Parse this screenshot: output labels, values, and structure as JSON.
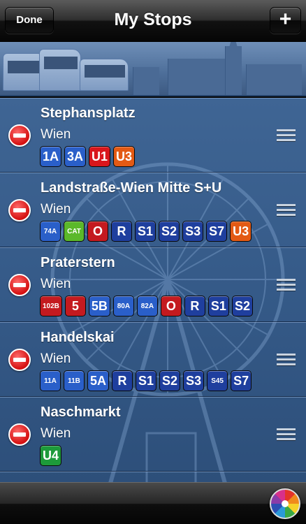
{
  "navbar": {
    "title": "My Stops",
    "done_label": "Done",
    "add_label": "+"
  },
  "stops": [
    {
      "name": "Stephansplatz",
      "city": "Wien",
      "lines": [
        {
          "label": "1A",
          "color": "#2a5fc9",
          "size": "l"
        },
        {
          "label": "3A",
          "color": "#2a5fc9",
          "size": "l"
        },
        {
          "label": "U1",
          "color": "#d9161c",
          "size": "l"
        },
        {
          "label": "U3",
          "color": "#e35a14",
          "size": "l"
        }
      ]
    },
    {
      "name": "Landstraße-Wien Mitte S+U",
      "city": "Wien",
      "lines": [
        {
          "label": "74A",
          "color": "#2a5fc9",
          "size": "s"
        },
        {
          "label": "CAT",
          "color": "#5bb82a",
          "size": "s"
        },
        {
          "label": "O",
          "color": "#c41a1f",
          "size": "l"
        },
        {
          "label": "R",
          "color": "#1f3f9e",
          "size": "l"
        },
        {
          "label": "S1",
          "color": "#1f3f9e",
          "size": "l"
        },
        {
          "label": "S2",
          "color": "#1f3f9e",
          "size": "l"
        },
        {
          "label": "S3",
          "color": "#1f3f9e",
          "size": "l"
        },
        {
          "label": "S7",
          "color": "#1f3f9e",
          "size": "l"
        },
        {
          "label": "U3",
          "color": "#e35a14",
          "size": "l"
        }
      ]
    },
    {
      "name": "Praterstern",
      "city": "Wien",
      "lines": [
        {
          "label": "102B",
          "color": "#c41a1f",
          "size": "s"
        },
        {
          "label": "5",
          "color": "#c41a1f",
          "size": "l"
        },
        {
          "label": "5B",
          "color": "#2a5fc9",
          "size": "l"
        },
        {
          "label": "80A",
          "color": "#2a5fc9",
          "size": "s"
        },
        {
          "label": "82A",
          "color": "#2a5fc9",
          "size": "s"
        },
        {
          "label": "O",
          "color": "#c41a1f",
          "size": "l"
        },
        {
          "label": "R",
          "color": "#1f3f9e",
          "size": "l"
        },
        {
          "label": "S1",
          "color": "#1f3f9e",
          "size": "l"
        },
        {
          "label": "S2",
          "color": "#1f3f9e",
          "size": "l"
        }
      ]
    },
    {
      "name": "Handelskai",
      "city": "Wien",
      "lines": [
        {
          "label": "11A",
          "color": "#2a5fc9",
          "size": "s"
        },
        {
          "label": "11B",
          "color": "#2a5fc9",
          "size": "s"
        },
        {
          "label": "5A",
          "color": "#2a5fc9",
          "size": "l"
        },
        {
          "label": "R",
          "color": "#1f3f9e",
          "size": "l"
        },
        {
          "label": "S1",
          "color": "#1f3f9e",
          "size": "l"
        },
        {
          "label": "S2",
          "color": "#1f3f9e",
          "size": "l"
        },
        {
          "label": "S3",
          "color": "#1f3f9e",
          "size": "l"
        },
        {
          "label": "S45",
          "color": "#1f3f9e",
          "size": "s"
        },
        {
          "label": "S7",
          "color": "#1f3f9e",
          "size": "l"
        }
      ]
    },
    {
      "name": "Naschmarkt",
      "city": "Wien",
      "lines": [
        {
          "label": "U4",
          "color": "#1d9a3a",
          "size": "l"
        }
      ]
    }
  ],
  "icons": {
    "delete": "minus-circle-icon",
    "reorder": "reorder-handle-icon",
    "theme": "color-wheel-icon"
  }
}
